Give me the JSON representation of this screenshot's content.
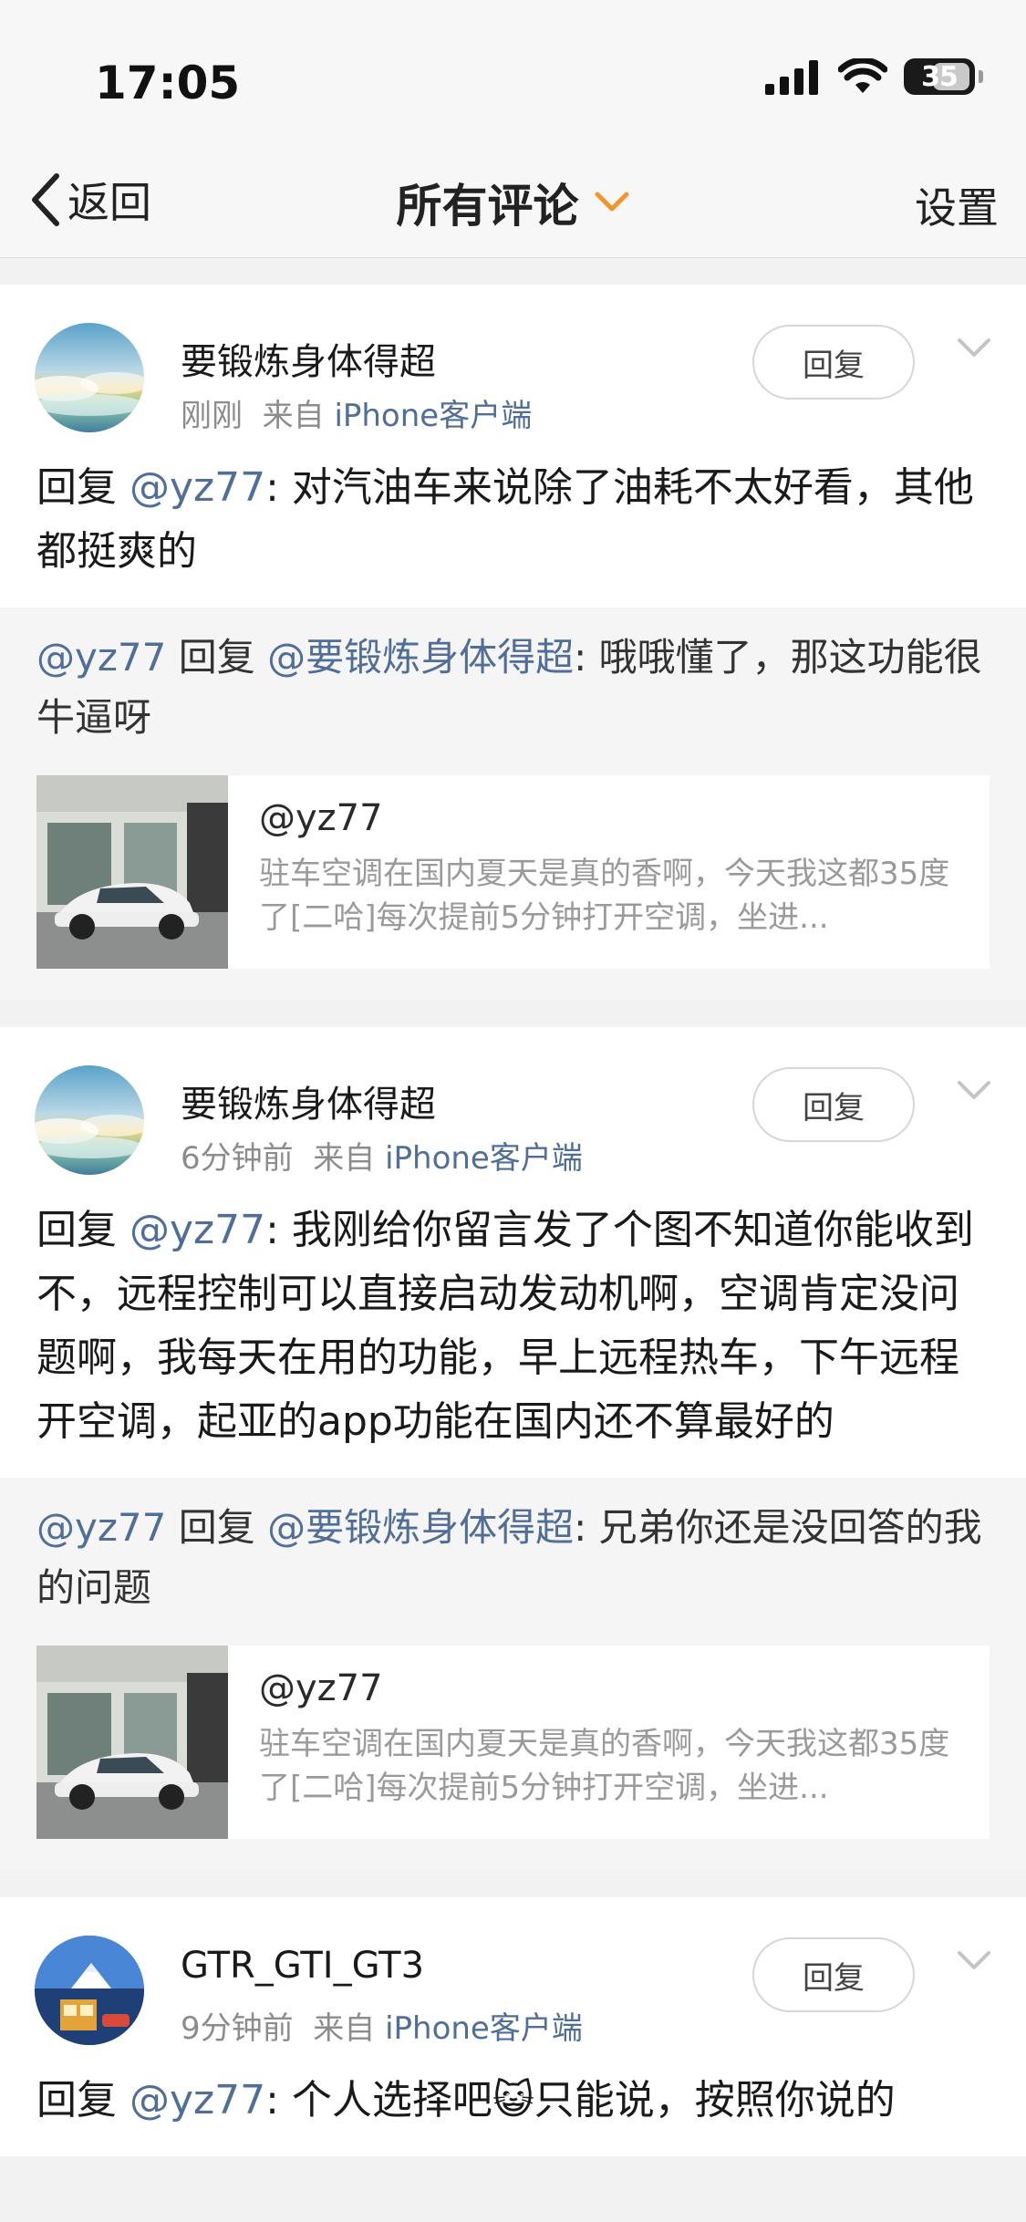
{
  "status": {
    "time": "17:05",
    "battery": "35"
  },
  "nav": {
    "back": "返回",
    "title": "所有评论",
    "settings": "设置"
  },
  "comments": [
    {
      "user": "要锻炼身体得超",
      "time": "刚刚",
      "source_prefix": "来自",
      "source": "iPhone客户端",
      "reply_label": "回复",
      "text_prefix": "回复",
      "mention": "@yz77",
      "text": ": 对汽油车来说除了油耗不太好看，其他都挺爽的",
      "quote": {
        "from": "@yz77",
        "mid": " 回复 ",
        "to": "@要锻炼身体得超",
        "text": ": 哦哦懂了，那这功能很牛逼呀"
      },
      "share": {
        "user": "@yz77",
        "desc": "驻车空调在国内夏天是真的香啊，今天我这都35度了[二哈]每次提前5分钟打开空调，坐进..."
      }
    },
    {
      "user": "要锻炼身体得超",
      "time": "6分钟前",
      "source_prefix": "来自",
      "source": "iPhone客户端",
      "reply_label": "回复",
      "text_prefix": "回复",
      "mention": "@yz77",
      "text": ": 我刚给你留言发了个图不知道你能收到不，远程控制可以直接启动发动机啊，空调肯定没问题啊，我每天在用的功能，早上远程热车，下午远程开空调，起亚的app功能在国内还不算最好的",
      "quote": {
        "from": "@yz77",
        "mid": " 回复 ",
        "to": "@要锻炼身体得超",
        "text": ": 兄弟你还是没回答的我的问题"
      },
      "share": {
        "user": "@yz77",
        "desc": "驻车空调在国内夏天是真的香啊，今天我这都35度了[二哈]每次提前5分钟打开空调，坐进..."
      }
    },
    {
      "user": "GTR_GTI_GT3",
      "time": "9分钟前",
      "source_prefix": "来自",
      "source": "iPhone客户端",
      "reply_label": "回复",
      "text_prefix": "回复",
      "mention": "@yz77",
      "text": ": 个人选择吧😺只能说，按照你说的"
    }
  ]
}
